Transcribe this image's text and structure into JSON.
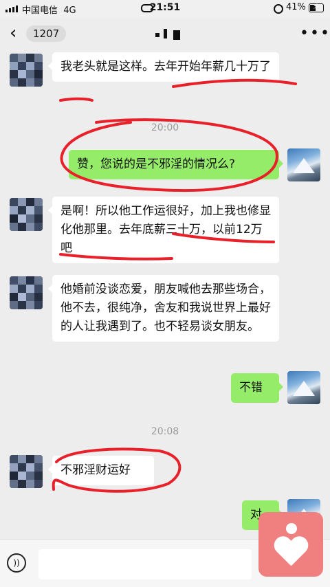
{
  "status_bar": {
    "carrier": "中国电信",
    "network": "4G",
    "time": "21:51",
    "battery": "41%",
    "battery_level": 0.41
  },
  "nav": {
    "unread_count": "1207",
    "back_icon": "chevron-left-icon",
    "more_icon": "more-icon"
  },
  "messages": [
    {
      "side": "left",
      "text": "我老头就是这样。去年开始年薪几十万了"
    },
    {
      "type": "time",
      "text": "20:00"
    },
    {
      "side": "right",
      "text": "赞，您说的是不邪淫的情况么?"
    },
    {
      "side": "left",
      "text": "是啊！所以他工作运很好，加上我也修显化他那里。去年底薪三十万，以前12万吧"
    },
    {
      "side": "left",
      "text": "他婚前没谈恋爱，朋友喊他去那些场合，他不去，很纯净，舍友和我说世界上最好的人让我遇到了。也不轻易谈女朋友。"
    },
    {
      "side": "right",
      "text": "不错"
    },
    {
      "type": "time",
      "text": "20:08"
    },
    {
      "side": "left",
      "text": "不邪淫财运好"
    },
    {
      "side": "right",
      "text": "对"
    }
  ],
  "colors": {
    "background": "#ededed",
    "bubble_self": "#95ec69",
    "bubble_other": "#ffffff",
    "annotation": "#e8202a",
    "logo": "#f08080"
  },
  "input_bar": {
    "voice_icon": "voice-icon"
  }
}
